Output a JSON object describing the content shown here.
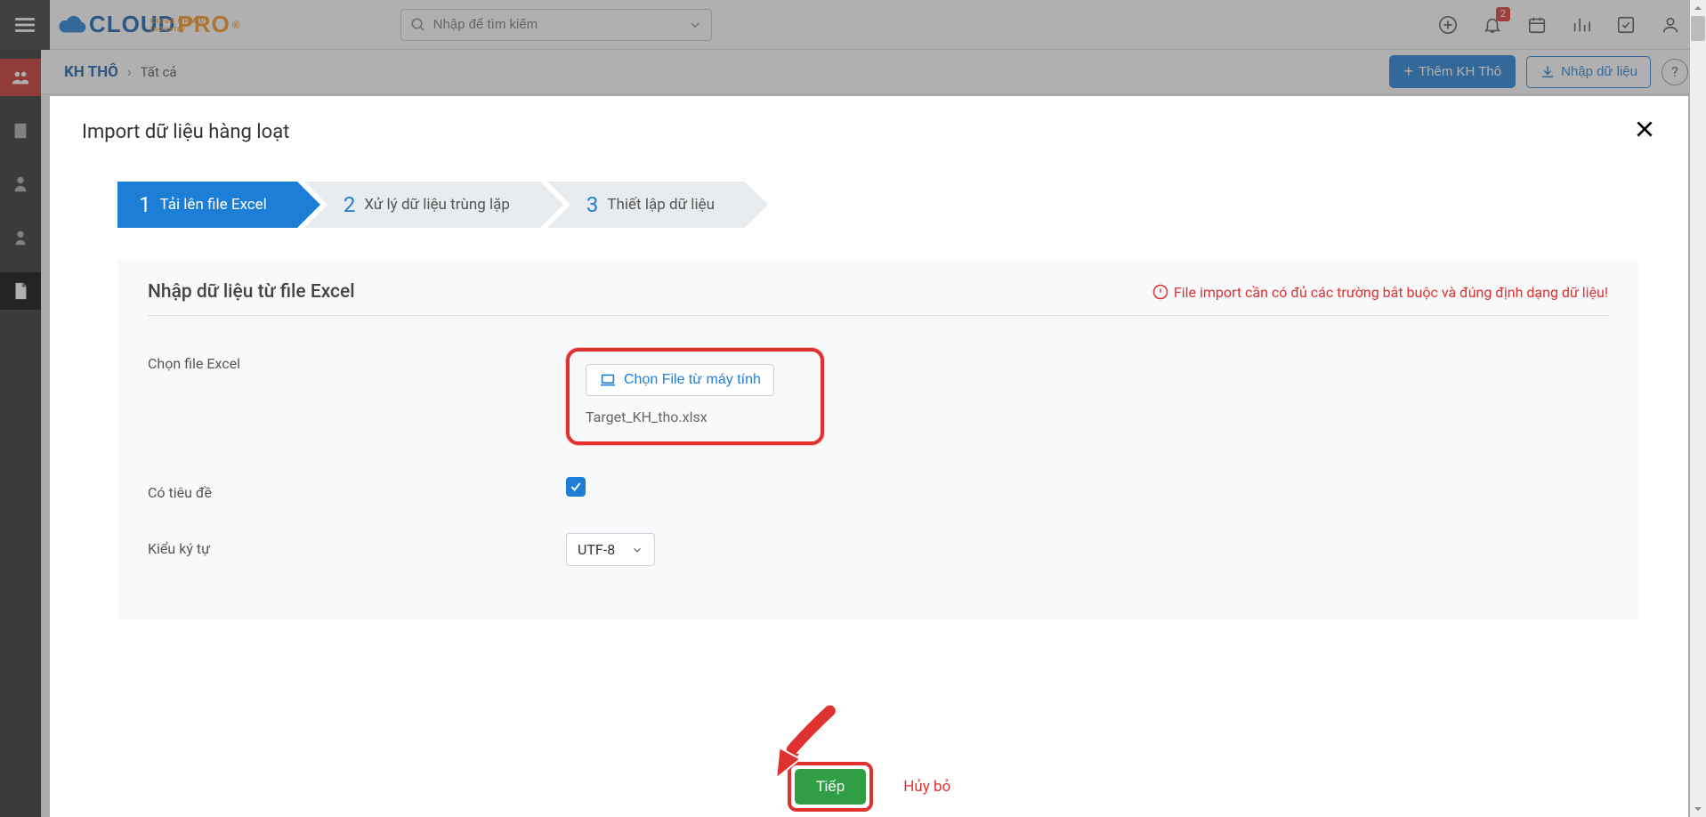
{
  "header": {
    "logo_text1": "CLOUD",
    "logo_text2": "PRO",
    "logo_sub": "Cloud CRM by Industry",
    "search_placeholder": "Nhập để tìm kiếm",
    "notif_badge": "2"
  },
  "subheader": {
    "breadcrumb_main": "KH THÔ",
    "breadcrumb_sub": "Tất cả",
    "add_button": "Thêm KH Thô",
    "import_button": "Nhập dữ liệu",
    "help": "?"
  },
  "modal": {
    "title": "Import dữ liệu hàng loạt",
    "steps": [
      {
        "num": "1",
        "label": "Tải lên file Excel"
      },
      {
        "num": "2",
        "label": "Xử lý dữ liệu trùng lặp"
      },
      {
        "num": "3",
        "label": "Thiết lập dữ liệu"
      }
    ],
    "card_title": "Nhập dữ liệu từ file Excel",
    "warning": "File import cần có đủ các trường bắt buộc và đúng định dạng dữ liệu!",
    "row_choose_label": "Chọn file Excel",
    "choose_button": "Chọn File từ máy tính",
    "file_name": "Target_KH_tho.xlsx",
    "row_header_label": "Có tiêu đề",
    "row_charset_label": "Kiểu ký tự",
    "charset_value": "UTF-8",
    "next_btn": "Tiếp",
    "cancel_btn": "Hủy bỏ"
  }
}
